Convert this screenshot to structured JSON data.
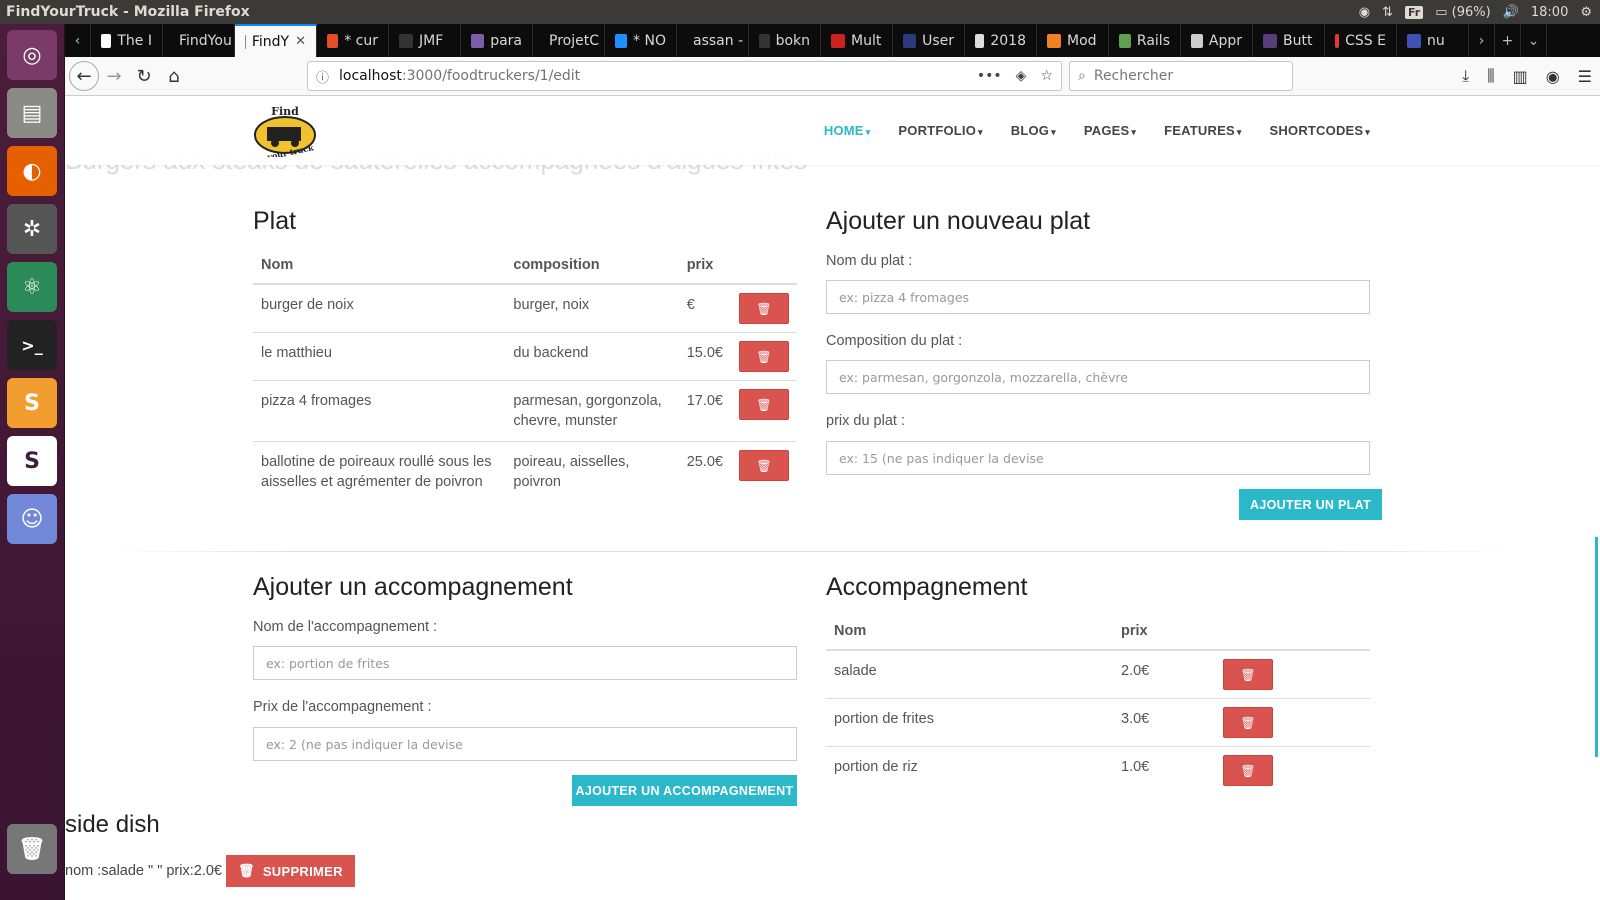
{
  "os": {
    "window_title": "FindYourTruck - Mozilla Firefox",
    "lang": "Fr",
    "battery": "(96%)",
    "time": "18:00"
  },
  "tabs": [
    {
      "label": "The I",
      "color": "#ffffff"
    },
    {
      "label": "FindYou",
      "color": "#888888"
    },
    {
      "label": "FindY",
      "color": "#888888",
      "active": true
    },
    {
      "label": "* cur",
      "color": "#e44d26"
    },
    {
      "label": "JMF",
      "color": "#333333"
    },
    {
      "label": "para",
      "color": "#7a5ea8"
    },
    {
      "label": "ProjetC",
      "color": "#888888"
    },
    {
      "label": "* NO",
      "color": "#1e90ff"
    },
    {
      "label": "assan - F",
      "color": "#888888"
    },
    {
      "label": "bokn",
      "color": "#333333"
    },
    {
      "label": "Mult",
      "color": "#cc2222"
    },
    {
      "label": "User",
      "color": "#2a3a7a"
    },
    {
      "label": "2018",
      "color": "#dddddd"
    },
    {
      "label": "Mod",
      "color": "#f48024"
    },
    {
      "label": "Rails",
      "color": "#5fa04e"
    },
    {
      "label": "Appr",
      "color": "#cccccc"
    },
    {
      "label": "Butt",
      "color": "#563d7c"
    },
    {
      "label": "CSS E",
      "color": "#e53935"
    },
    {
      "label": "nu",
      "color": "#3f51b5"
    }
  ],
  "nav": {
    "url_host": "localhost",
    "url_path": ":3000/foodtruckers/1/edit",
    "search_placeholder": "Rechercher"
  },
  "site": {
    "ghost_text": "Burgers aux steaks de sauterelles accompagnées d'algues frites",
    "logo_top": "Find",
    "logo_bottom": "your truck",
    "menu": [
      "HOME",
      "PORTFOLIO",
      "BLOG",
      "PAGES",
      "FEATURES",
      "SHORTCODES"
    ]
  },
  "plats": {
    "title": "Plat",
    "headers": [
      "Nom",
      "composition",
      "prix"
    ],
    "rows": [
      {
        "nom": "burger de noix",
        "composition": "burger, noix",
        "prix": "€"
      },
      {
        "nom": "le matthieu",
        "composition": "du backend",
        "prix": "15.0€"
      },
      {
        "nom": "pizza 4 fromages",
        "composition": "parmesan, gorgonzola, chevre, munster",
        "prix": "17.0€"
      },
      {
        "nom": "ballotine de poireaux roullé sous les aisselles et agrémenter de poivron",
        "composition": "poireau, aisselles, poivron",
        "prix": "25.0€"
      }
    ]
  },
  "new_plat": {
    "title": "Ajouter un nouveau plat",
    "nom_label": "Nom du plat :",
    "nom_placeholder": "ex: pizza 4 fromages",
    "compo_label": "Composition du plat :",
    "compo_placeholder": "ex: parmesan, gorgonzola, mozzarella, chèvre",
    "prix_label": "prix du plat :",
    "prix_placeholder": "ex: 15 (ne pas indiquer la devise",
    "submit": "AJOUTER UN PLAT"
  },
  "new_accomp": {
    "title": "Ajouter un accompagnement",
    "nom_label": "Nom de l'accompagnement :",
    "nom_placeholder": "ex: portion de frites",
    "prix_label": "Prix de l'accompagnement :",
    "prix_placeholder": "ex: 2 (ne pas indiquer la devise",
    "submit": "AJOUTER UN ACCOMPAGNEMENT"
  },
  "accomp": {
    "title": "Accompagnement",
    "headers": [
      "Nom",
      "prix"
    ],
    "rows": [
      {
        "nom": "salade",
        "prix": "2.0€"
      },
      {
        "nom": "portion de frites",
        "prix": "3.0€"
      },
      {
        "nom": "portion de riz",
        "prix": "1.0€"
      }
    ]
  },
  "side_dish": {
    "title": "side dish",
    "line": "nom :salade \" \" prix:2.0€",
    "delete_label": "SUPPRIMER"
  },
  "colors": {
    "accent": "#2bb8c8",
    "danger": "#d9534f"
  }
}
